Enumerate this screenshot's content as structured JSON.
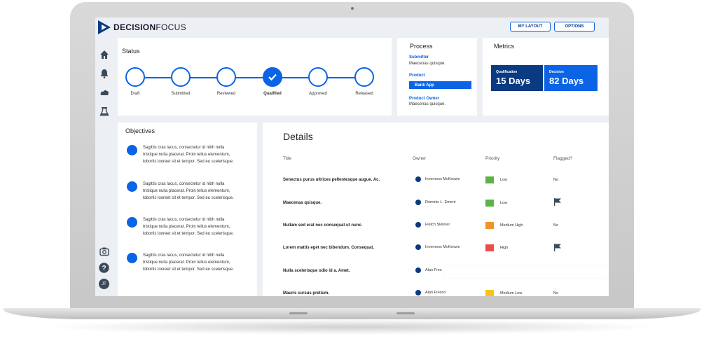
{
  "app": {
    "logo_part1": "DECISION",
    "logo_part2": "FOCUS",
    "my_layout_label": "MY LAYOUT",
    "options_label": "OPTIONS",
    "brand_color": "#0b63e5"
  },
  "sidebar": {
    "icons": [
      "home-icon",
      "bell-icon",
      "cloud-icon",
      "flask-icon",
      "camera-icon",
      "help-icon"
    ],
    "avatar_initials": "JT"
  },
  "status": {
    "title": "Status",
    "steps": [
      {
        "label": "Draft",
        "done": false
      },
      {
        "label": "Submitted",
        "done": false
      },
      {
        "label": "Reviewed",
        "done": false
      },
      {
        "label": "Qualified",
        "done": true
      },
      {
        "label": "Approved",
        "done": false
      },
      {
        "label": "Released",
        "done": false
      }
    ]
  },
  "process": {
    "title": "Process",
    "submitter_label": "Submitter",
    "submitter_value": "Maecenas quisque.",
    "product_label": "Product",
    "product_value": "Bank App",
    "owner_label": "Product Owner",
    "owner_value": "Maecenas quisque."
  },
  "metrics": {
    "title": "Metrics",
    "items": [
      {
        "label": "Qualification",
        "value": "15 Days",
        "color": "#0a3a82"
      },
      {
        "label": "Decision",
        "value": "82 Days",
        "color": "#0b63e5"
      }
    ]
  },
  "objectives": {
    "title": "Objectives",
    "items": [
      {
        "line1": "Sagittis cras lacus, consectetur id nibh nulla",
        "line2": "tristique nulla placerat. Proin tellus elementum,",
        "line3": "lobortis looreet sit et tempor. Sed eu scelerisque."
      },
      {
        "line1": "Sagittis cras lacus, consectetur id nibh nulla",
        "line2": "tristique nulla placerat. Proin tellus elementum,",
        "line3": "lobortis looreet sit et tempor. Sed eu scelerisque."
      },
      {
        "line1": "Sagittis cras lacus, consectetur id nibh nulla",
        "line2": "tristique nulla placerat. Proin tellus elementum,",
        "line3": "lobortis looreet sit et tempor. Sed eu scelerisque."
      },
      {
        "line1": "Sagittis cras lacus, consectetur id nibh nulla",
        "line2": "tristique nulla placerat. Proin tellus elementum,",
        "line3": "lobortis looreet sit et tempor. Sed eu scelerisque."
      }
    ]
  },
  "details": {
    "title": "Details",
    "columns": {
      "title": "Title",
      "owner": "Owner",
      "priority": "Priority",
      "flagged": "Flagged?"
    },
    "rows": [
      {
        "title": "Senectus purus ultrices pellentesque augue. Ac.",
        "owner": "Inverness McKenzie",
        "priority": "Low",
        "priority_color": "#5bb544",
        "flagged": "No"
      },
      {
        "title": "Maecenas quisque.",
        "owner": "Dominic L. Ement",
        "priority": "Low",
        "priority_color": "#5bb544",
        "flagged": "flag"
      },
      {
        "title": "Nullam sed erat nec consequat ut nunc.",
        "owner": "Fletch Skinner",
        "priority": "Medium High",
        "priority_color": "#f0932b",
        "flagged": "No"
      },
      {
        "title": "Lorem mattis eget nec bibendum. Consequat.",
        "owner": "Inverness McKenzie",
        "priority": "High",
        "priority_color": "#eb4d4b",
        "flagged": "flag"
      },
      {
        "title": "Nulla scelerisque odio id a. Amet.",
        "owner": "Alan Fres",
        "priority": "",
        "priority_color": "",
        "flagged": ""
      },
      {
        "title": "Mauris cursus pretium.",
        "owner": "Alan Fresco",
        "priority": "Medium Low",
        "priority_color": "#f5c518",
        "flagged": "No"
      }
    ]
  }
}
